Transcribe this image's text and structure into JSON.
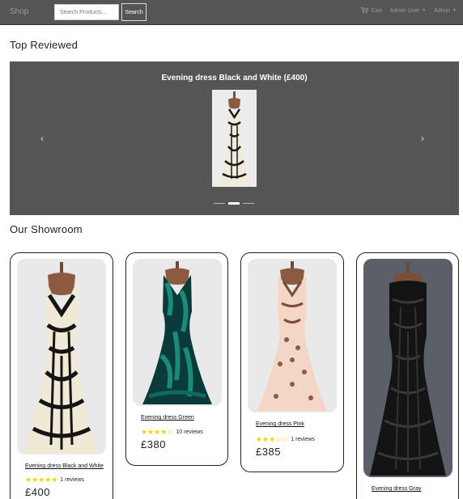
{
  "navbar": {
    "brand": "Shop",
    "search_placeholder": "Search Products...",
    "search_button": "Search",
    "cart_label": "Cart",
    "admin_user_label": "Admin User",
    "admin_label": "Admin",
    "icons": {
      "cart": "shopping-cart-icon",
      "caret": "caret-down-icon"
    }
  },
  "top_reviewed": {
    "title": "Top Reviewed",
    "carousel": {
      "caption": "Evening dress Black and White (£400)",
      "prev_icon": "chevron-left-icon",
      "next_icon": "chevron-right-icon",
      "slide_count": 3,
      "active_slide": 2
    }
  },
  "showroom": {
    "title": "Our Showroom",
    "products": [
      {
        "name": "Evening dress Black and White",
        "stars": "★★★★★",
        "reviews": "1 reviews",
        "price": "£400",
        "rating": 5
      },
      {
        "name": "Evening dress Green",
        "stars": "★★★★☆",
        "reviews": "10 reviews",
        "price": "£380",
        "rating": 4
      },
      {
        "name": "Evening dress Pink",
        "stars": "★★★☆☆",
        "reviews": "1 reviews",
        "price": "£385",
        "rating": 3
      },
      {
        "name": "Evening dress Gray",
        "stars": "",
        "reviews": "",
        "price": ""
      }
    ]
  },
  "colors": {
    "navbar_bg": "#555555",
    "carousel_bg": "#555555",
    "star": "#f5d000"
  }
}
